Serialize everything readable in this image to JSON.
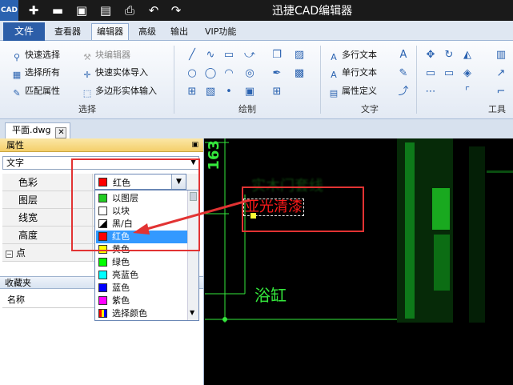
{
  "app": {
    "title": "迅捷CAD编辑器",
    "logo_text": "CAD"
  },
  "menu": {
    "file": "文件",
    "viewer": "查看器",
    "editor": "编辑器",
    "advanced": "高级",
    "output": "输出",
    "vip": "VIP功能"
  },
  "ribbon": {
    "select": {
      "label": "选择",
      "quick_select": "快速选择",
      "select_all": "选择所有",
      "match_props": "匹配属性",
      "block_editor": "块编辑器",
      "quick_entity_import": "快速实体导入",
      "polygon_entity_input": "多边形实体输入"
    },
    "draw": {
      "label": "绘制"
    },
    "text": {
      "label": "文字",
      "multiline": "多行文本",
      "singleline": "单行文本",
      "attr_def": "属性定义"
    },
    "tools": {
      "label": "工具"
    }
  },
  "doc": {
    "tab": "平面.dwg"
  },
  "panel": {
    "title": "属性",
    "type": "文字",
    "props": [
      {
        "name": "色彩"
      },
      {
        "name": "图层"
      },
      {
        "name": "线宽"
      },
      {
        "name": "高度"
      },
      {
        "name": "点"
      }
    ],
    "favorites_title": "收藏夹",
    "favorites_col": "名称"
  },
  "color_combo": {
    "value": "红色"
  },
  "color_options": [
    {
      "label": "以图层",
      "color": "#22cc22"
    },
    {
      "label": "以块",
      "color": "#ffffff"
    },
    {
      "label": "黑/白",
      "color": "#000000"
    },
    {
      "label": "红色",
      "color": "#ff0000"
    },
    {
      "label": "黄色",
      "color": "#ffff00"
    },
    {
      "label": "绿色",
      "color": "#00ff00"
    },
    {
      "label": "亮蓝色",
      "color": "#00ffff"
    },
    {
      "label": "蓝色",
      "color": "#0000ff"
    },
    {
      "label": "紫色",
      "color": "#ff00ff"
    },
    {
      "label": "选择颜色",
      "color": "#ffaa00"
    }
  ],
  "canvas": {
    "dimension": "163",
    "selected_text": "亚光清漆",
    "label_bathtub": "浴缸",
    "blurred_text": "实木门套线"
  }
}
